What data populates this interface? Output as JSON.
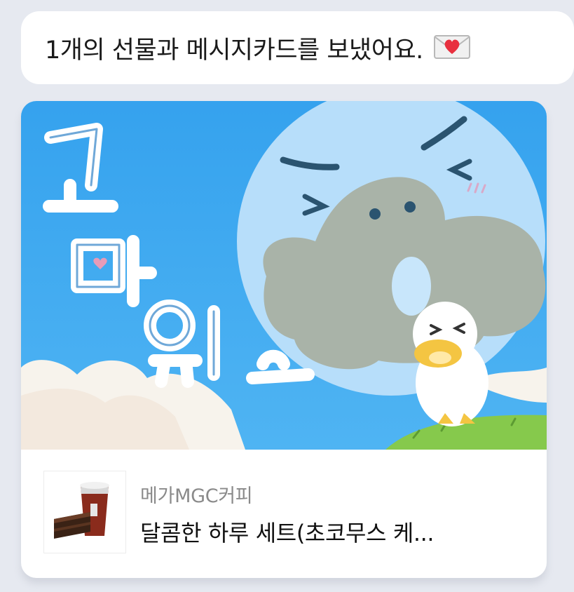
{
  "message": {
    "text": "1개의 선물과 메시지카드를 보냈어요.",
    "icon": "love-letter-icon"
  },
  "gift_card": {
    "image": {
      "text": "고마워요",
      "description_icon": "thank-you-card-illustration"
    },
    "product": {
      "brand": "메가MGC커피",
      "name": "달콤한 하루 세트(초코무스 케...",
      "thumbnail_icon": "coffee-and-cake-icon"
    }
  },
  "colors": {
    "background": "#e6e9f0",
    "bubble": "#ffffff",
    "sky": "#3fa7ee",
    "cloud_gray": "#a9b3a8",
    "heart": "#e8303f"
  }
}
